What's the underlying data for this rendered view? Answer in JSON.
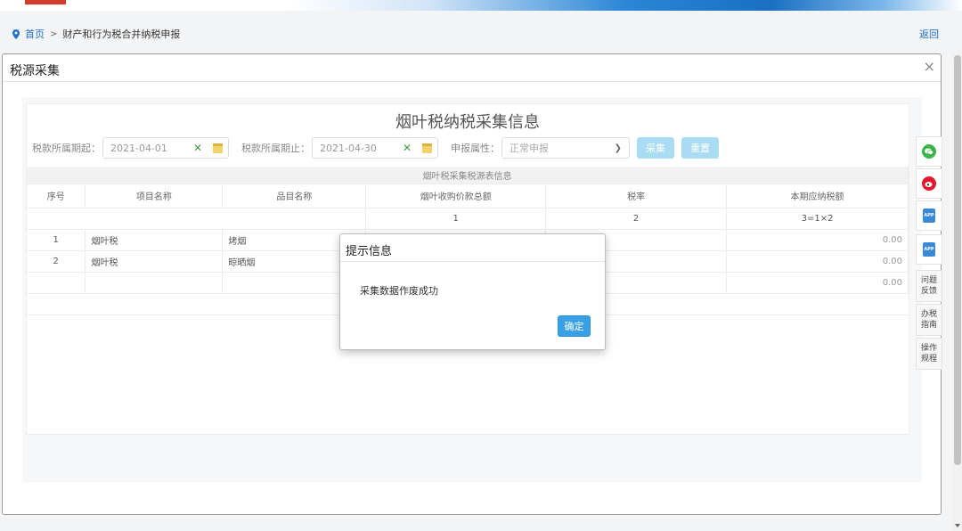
{
  "breadcrumb": {
    "home": "首页",
    "separator": ">",
    "current": "财产和行为税合并纳税申报"
  },
  "header": {
    "back_label": "返回"
  },
  "modal": {
    "title": "税源采集",
    "close_icon": "close-icon"
  },
  "form": {
    "title": "烟叶税纳税采集信息",
    "start_label": "税款所属期起：",
    "start_value": "2021-04-01",
    "end_label": "税款所属期止：",
    "end_value": "2021-04-30",
    "type_label": "申报属性：",
    "type_value": "正常申报",
    "collect_label": "采集",
    "reset_label": "重置"
  },
  "table": {
    "caption": "烟叶税采集税源表信息",
    "columns": [
      "序号",
      "项目名称",
      "品目名称",
      "烟叶收购价款总额",
      "税率",
      "本期应纳税额"
    ],
    "index_row": [
      "1",
      "2",
      "3=1×2"
    ],
    "rows": [
      {
        "no": "1",
        "item": "烟叶税",
        "sub": "烤烟",
        "amount": "0.00"
      },
      {
        "no": "2",
        "item": "烟叶税",
        "sub": "晾晒烟",
        "amount": "0.00"
      }
    ],
    "total_amount": "0.00"
  },
  "dialog": {
    "title": "提示信息",
    "message": "采集数据作废成功",
    "ok_label": "确定"
  },
  "sidebar": {
    "feedback": [
      "问题",
      "反馈"
    ],
    "guide": [
      "办税",
      "指南"
    ],
    "procedure": [
      "操作",
      "规程"
    ],
    "app_label": "APP"
  },
  "colors": {
    "accent": "#3aa0e6",
    "link": "#1e6ec8",
    "wechat": "#3ab54a",
    "weibo": "#e6162d"
  }
}
